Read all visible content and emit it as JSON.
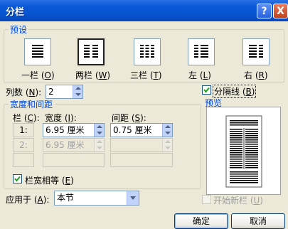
{
  "title": "分栏",
  "title_buttons": {
    "help": "?",
    "close": "X"
  },
  "presets": {
    "legend": "预设",
    "items": [
      {
        "label_pre": "一栏 (",
        "key": "O",
        "label_post": ")"
      },
      {
        "label_pre": "两栏 (",
        "key": "W",
        "label_post": ")",
        "selected": true
      },
      {
        "label_pre": "三栏 (",
        "key": "T",
        "label_post": ")"
      },
      {
        "label_pre": "左 (",
        "key": "L",
        "label_post": ")"
      },
      {
        "label_pre": "右 (",
        "key": "R",
        "label_post": ")"
      }
    ]
  },
  "col_count": {
    "label_pre": "列数 (",
    "key": "N",
    "label_post": "):",
    "value": "2"
  },
  "separator": {
    "label_pre": "分隔线 (",
    "key": "B",
    "label_post": ")",
    "checked": true
  },
  "width_spacing": {
    "legend": "宽度和间距",
    "col_header": {
      "pre": "栏 (",
      "key": "C",
      "post": "):"
    },
    "width_header": {
      "pre": "宽度 (",
      "key": "I",
      "post": "):"
    },
    "spacing_header": {
      "pre": "间距 (",
      "key": "S",
      "post": "):"
    },
    "rows": [
      {
        "num": "1:",
        "width": "6.95 厘米",
        "spacing": "0.75 厘米",
        "enabled": true
      },
      {
        "num": "2:",
        "width": "6.95 厘米",
        "spacing": "",
        "enabled": false
      },
      {
        "num": "",
        "width": "",
        "spacing": "",
        "enabled": false
      }
    ],
    "equal_width": {
      "label_pre": "栏宽相等 (",
      "key": "E",
      "label_post": ")",
      "checked": true
    }
  },
  "preview": {
    "legend": "预览"
  },
  "apply_to": {
    "label_pre": "应用于 (",
    "key": "A",
    "label_post": "):",
    "value": "本节"
  },
  "new_column": {
    "label_pre": "开始新栏 (",
    "key": "U",
    "label_post": ")",
    "checked": false,
    "enabled": false
  },
  "buttons": {
    "ok": "确定",
    "cancel": "取消"
  }
}
